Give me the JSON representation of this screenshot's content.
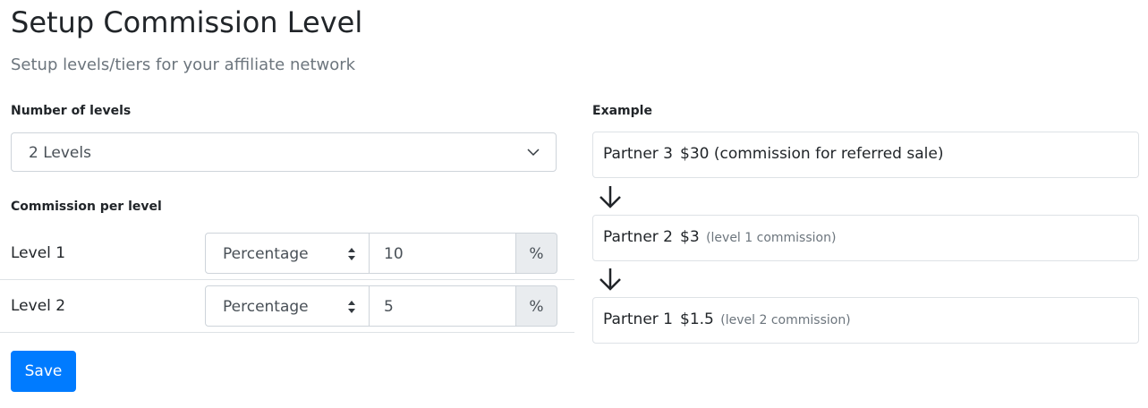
{
  "header": {
    "title": "Setup Commission Level",
    "subtitle": "Setup levels/tiers for your affiliate network"
  },
  "levels_field": {
    "label": "Number of levels",
    "selected": "2 Levels"
  },
  "commission": {
    "label": "Commission per level",
    "rows": [
      {
        "label": "Level 1",
        "type": "Percentage",
        "value": "10",
        "unit": "%"
      },
      {
        "label": "Level 2",
        "type": "Percentage",
        "value": "5",
        "unit": "%"
      }
    ]
  },
  "save_label": "Save",
  "example": {
    "label": "Example",
    "items": [
      {
        "partner": "Partner 3",
        "amount": "$30 (commission for referred sale)",
        "note": ""
      },
      {
        "partner": "Partner 2",
        "amount": "$3",
        "note": "(level 1 commission)"
      },
      {
        "partner": "Partner 1",
        "amount": "$1.5",
        "note": "(level 2 commission)"
      }
    ]
  },
  "colors": {
    "primary": "#007bff",
    "muted": "#6c757d",
    "border": "#ced4da",
    "addon_bg": "#e9ecef"
  },
  "icons": {
    "select": "chevron-down-icon",
    "type_select": "sort-arrows-icon",
    "flow": "arrow-down-icon"
  }
}
